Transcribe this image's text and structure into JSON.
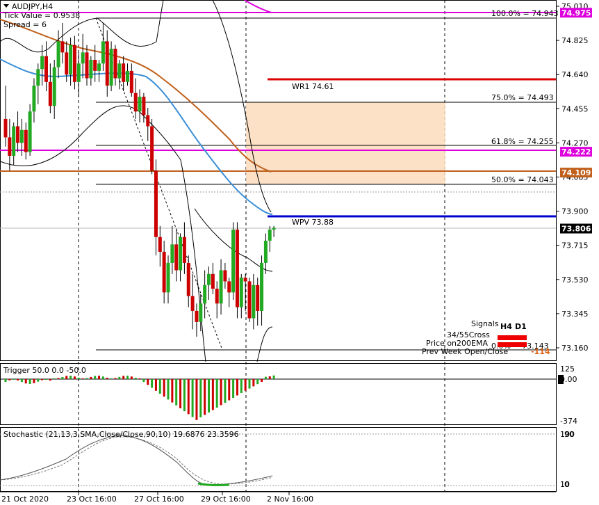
{
  "header": {
    "symbol_tf": "AUDJPY,H4",
    "tick_value": "Tick Value = 0.9538",
    "spread": "Spread = 6"
  },
  "colors": {
    "bull": "#22aa22",
    "bear": "#cc0000",
    "fib": "#000000",
    "pivot_wpv": "#0000cc",
    "pivot_wr1": "#dd0000",
    "magenta": "#dd00dd",
    "ema_brown": "#c0601c",
    "sma_blue": "#3a8fd8",
    "zone": "#fbdcbc"
  },
  "price_axis": {
    "ticks": [
      "75.010",
      "74.825",
      "74.640",
      "74.455",
      "74.270",
      "74.085",
      "73.900",
      "73.715",
      "73.530",
      "73.345",
      "73.160"
    ],
    "labels": [
      {
        "text": "74.975",
        "bg": "#dd00dd",
        "fg": "#ffffff"
      },
      {
        "text": "74.222",
        "bg": "#dd00dd",
        "fg": "#ffffff"
      },
      {
        "text": "74.109",
        "bg": "#c0601c",
        "fg": "#ffffff"
      },
      {
        "text": "73.806",
        "bg": "#000000",
        "fg": "#ffffff"
      }
    ]
  },
  "levels": {
    "fib100": "100.0% = 74.943",
    "fib75": "75.0% = 74.493",
    "fib618": "61.8% = 74.255",
    "fib50": "50.0% = 74.043",
    "fib0": "0.0% = 73.143",
    "wr1": "WR1   74.61",
    "wpv": "WPV   73.88"
  },
  "signals": {
    "title": "Signals",
    "col_h4": "H4",
    "col_d1": "D1",
    "rows": [
      "34/55Cross",
      "Price on200EMA"
    ],
    "prev_week": "Prev Week Open/Close",
    "prev_week_value": "-114"
  },
  "trigger": {
    "label": "Trigger 50.0 0.0 -50.0",
    "ticks": [
      "125",
      "0.00",
      "-374"
    ]
  },
  "stochastic": {
    "label": "Stochastic (21,13,3,SMA,Close/Close,90,10) 19.6876 23.3596",
    "ticks": [
      "100",
      "90",
      "10",
      "0"
    ]
  },
  "time_axis": [
    "21 Oct 2020",
    "23 Oct 16:00",
    "27 Oct 16:00",
    "29 Oct 16:00",
    "2 Nov 16:00"
  ],
  "chart_data": {
    "type": "candlestick",
    "symbol": "AUDJPY",
    "timeframe": "H4",
    "ylim": [
      73.1,
      75.03
    ],
    "candles": [
      [
        74.4,
        74.58,
        74.25,
        74.3
      ],
      [
        74.3,
        74.4,
        74.12,
        74.2
      ],
      [
        74.2,
        74.38,
        74.15,
        74.36
      ],
      [
        74.36,
        74.44,
        74.22,
        74.27
      ],
      [
        74.27,
        74.4,
        74.2,
        74.34
      ],
      [
        74.34,
        74.38,
        74.18,
        74.22
      ],
      [
        74.22,
        74.48,
        74.2,
        74.44
      ],
      [
        74.44,
        74.62,
        74.38,
        74.58
      ],
      [
        74.58,
        74.7,
        74.48,
        74.67
      ],
      [
        74.67,
        74.8,
        74.58,
        74.74
      ],
      [
        74.74,
        74.82,
        74.55,
        74.6
      ],
      [
        74.6,
        74.7,
        74.43,
        74.47
      ],
      [
        74.47,
        74.72,
        74.4,
        74.68
      ],
      [
        74.68,
        74.88,
        74.62,
        74.82
      ],
      [
        74.82,
        74.92,
        74.7,
        74.76
      ],
      [
        74.76,
        74.82,
        74.6,
        74.64
      ],
      [
        74.64,
        74.84,
        74.58,
        74.8
      ],
      [
        74.8,
        74.85,
        74.56,
        74.6
      ],
      [
        74.6,
        74.76,
        74.52,
        74.7
      ],
      [
        74.7,
        74.86,
        74.62,
        74.76
      ],
      [
        74.76,
        74.8,
        74.58,
        74.62
      ],
      [
        74.62,
        74.74,
        74.58,
        74.72
      ],
      [
        74.72,
        74.8,
        74.6,
        74.66
      ],
      [
        74.66,
        74.72,
        74.6,
        74.7
      ],
      [
        74.7,
        74.92,
        74.66,
        74.82
      ],
      [
        74.82,
        74.88,
        74.52,
        74.58
      ],
      [
        74.58,
        74.82,
        74.55,
        74.78
      ],
      [
        74.78,
        74.8,
        74.58,
        74.62
      ],
      [
        74.62,
        74.72,
        74.56,
        74.7
      ],
      [
        74.7,
        74.74,
        74.55,
        74.6
      ],
      [
        74.6,
        74.7,
        74.58,
        74.66
      ],
      [
        74.66,
        74.7,
        74.52,
        74.54
      ],
      [
        74.54,
        74.62,
        74.4,
        74.44
      ],
      [
        74.44,
        74.56,
        74.38,
        74.52
      ],
      [
        74.52,
        74.54,
        74.38,
        74.42
      ],
      [
        74.42,
        74.46,
        74.28,
        74.36
      ],
      [
        74.36,
        74.4,
        74.1,
        74.12
      ],
      [
        74.12,
        74.18,
        73.66,
        73.76
      ],
      [
        73.76,
        73.82,
        73.6,
        73.68
      ],
      [
        73.68,
        73.74,
        73.4,
        73.46
      ],
      [
        73.46,
        73.66,
        73.4,
        73.62
      ],
      [
        73.62,
        73.82,
        73.56,
        73.72
      ],
      [
        73.72,
        73.8,
        73.52,
        73.58
      ],
      [
        73.58,
        73.78,
        73.52,
        73.76
      ],
      [
        73.76,
        73.84,
        73.56,
        73.62
      ],
      [
        73.62,
        73.66,
        73.38,
        73.44
      ],
      [
        73.44,
        73.56,
        73.26,
        73.36
      ],
      [
        73.36,
        73.4,
        73.22,
        73.3
      ],
      [
        73.3,
        73.45,
        73.25,
        73.4
      ],
      [
        73.4,
        73.58,
        73.32,
        73.5
      ],
      [
        73.5,
        73.6,
        73.42,
        73.56
      ],
      [
        73.56,
        73.62,
        73.45,
        73.48
      ],
      [
        73.48,
        73.52,
        73.32,
        73.4
      ],
      [
        73.4,
        73.64,
        73.34,
        73.58
      ],
      [
        73.58,
        73.62,
        73.48,
        73.52
      ],
      [
        73.52,
        73.54,
        73.38,
        73.46
      ],
      [
        73.46,
        73.84,
        73.42,
        73.8
      ],
      [
        73.8,
        73.84,
        73.32,
        73.38
      ],
      [
        73.38,
        73.56,
        73.32,
        73.54
      ],
      [
        73.54,
        73.56,
        73.36,
        73.52
      ],
      [
        73.52,
        73.54,
        73.3,
        73.32
      ],
      [
        73.32,
        73.56,
        73.26,
        73.5
      ],
      [
        73.5,
        73.54,
        73.28,
        73.36
      ],
      [
        73.36,
        73.66,
        73.28,
        73.62
      ],
      [
        73.62,
        73.78,
        73.56,
        73.74
      ],
      [
        73.74,
        73.82,
        73.68,
        73.8
      ],
      [
        73.8,
        73.82,
        73.76,
        73.81
      ]
    ]
  }
}
